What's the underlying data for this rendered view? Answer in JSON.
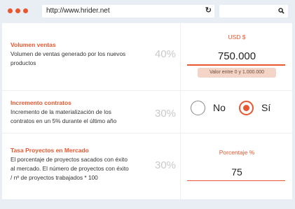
{
  "browser": {
    "url": "http://www.hrider.net",
    "reload_glyph": "↻",
    "search_icon": "search-icon"
  },
  "colors": {
    "accent": "#e8572f",
    "hint_bg": "#f4d4c6",
    "percent_gray": "#c9c9c9"
  },
  "rows": [
    {
      "title": "Volumen ventas",
      "desc_lines": [
        "Volumen de ventas generado por los nuevos",
        "productos"
      ],
      "weight": "40%",
      "unit": "USD $",
      "value": "750.000",
      "hint": "Valor entre 0 y 1.000.000"
    },
    {
      "title": "Incremento contratos",
      "desc_lines": [
        "Incremento de la materialización de los",
        "contratos en un 5% durante el último año"
      ],
      "weight": "30%",
      "options": [
        {
          "label": "No",
          "selected": false
        },
        {
          "label": "Sí",
          "selected": true
        }
      ]
    },
    {
      "title": "Tasa Proyectos en Mercado",
      "desc_lines": [
        "El porcentaje de proyectos sacados con éxito",
        "al mercado. El número de proyectos con éxito",
        "/ nº de proyectos trabajados * 100"
      ],
      "weight": "30%",
      "unit": "Porcentaje %",
      "value": "75"
    }
  ]
}
